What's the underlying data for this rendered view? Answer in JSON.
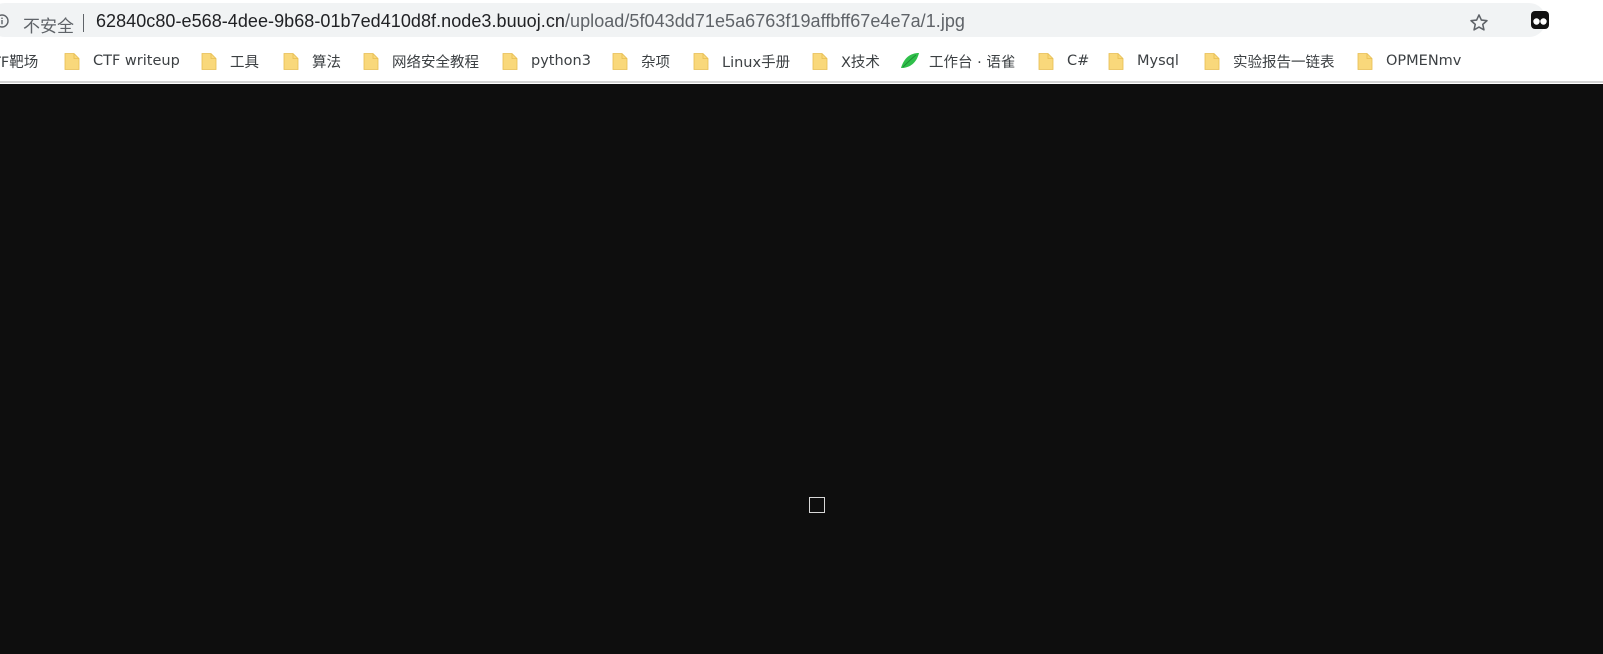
{
  "address_bar": {
    "security_label": "不安全",
    "url_host": "62840c80-e568-4dee-9b68-01b7ed410d8f.node3.buuoj.cn",
    "url_path": "/upload/5f043dd71e5a6763f19affbff67e4e7a/1.jpg"
  },
  "bookmarks": [
    {
      "label": "TF靶场",
      "icon": "folder-icon"
    },
    {
      "label": "CTF writeup",
      "icon": "folder-icon"
    },
    {
      "label": "工具",
      "icon": "folder-icon"
    },
    {
      "label": "算法",
      "icon": "folder-icon"
    },
    {
      "label": "网络安全教程",
      "icon": "folder-icon"
    },
    {
      "label": "python3",
      "icon": "folder-icon"
    },
    {
      "label": "杂项",
      "icon": "folder-icon"
    },
    {
      "label": "Linux手册",
      "icon": "folder-icon"
    },
    {
      "label": "X技术",
      "icon": "folder-icon"
    },
    {
      "label": "工作台 · 语雀",
      "icon": "yuque-leaf-icon"
    },
    {
      "label": "C#",
      "icon": "folder-icon"
    },
    {
      "label": "Mysql",
      "icon": "folder-icon"
    },
    {
      "label": "实验报告一链表",
      "icon": "folder-icon"
    },
    {
      "label": "OPMENmv",
      "icon": "folder-icon"
    }
  ],
  "colors": {
    "viewport_background": "#0e0e0e",
    "folder": "#f9d87b",
    "leaf": "#2fbf4a"
  },
  "viewport": {
    "content": "broken-image-icon"
  }
}
